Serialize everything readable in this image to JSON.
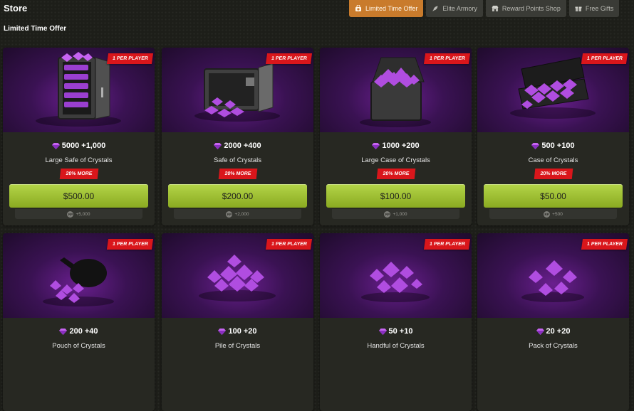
{
  "header": {
    "title": "Store",
    "section_title": "Limited Time Offer",
    "tabs": [
      {
        "label": "Limited Time Offer",
        "icon": "clock-bag-icon",
        "active": true
      },
      {
        "label": "Elite Armory",
        "icon": "rocket-icon",
        "active": false
      },
      {
        "label": "Reward Points Shop",
        "icon": "shop-icon",
        "active": false
      },
      {
        "label": "Free Gifts",
        "icon": "gift-icon",
        "active": false
      }
    ]
  },
  "colors": {
    "accent_tab": "#c97b2c",
    "buy_button": "#a4c637",
    "badge_red": "#d9161b",
    "crystal_purple": "#b04de0"
  },
  "cards": [
    {
      "badge": "1 PER PLAYER",
      "amount": "5000",
      "bonus": "+1,000",
      "name": "Large Safe of Crystals",
      "more": "20% MORE",
      "price": "$500.00",
      "rp_icon": "RP",
      "rp": "+5,000",
      "image": "large-safe-icon"
    },
    {
      "badge": "1 PER PLAYER",
      "amount": "2000",
      "bonus": "+400",
      "name": "Safe of Crystals",
      "more": "20% MORE",
      "price": "$200.00",
      "rp_icon": "RP",
      "rp": "+2,000",
      "image": "safe-icon"
    },
    {
      "badge": "1 PER PLAYER",
      "amount": "1000",
      "bonus": "+200",
      "name": "Large Case of Crystals",
      "more": "20% MORE",
      "price": "$100.00",
      "rp_icon": "RP",
      "rp": "+1,000",
      "image": "large-case-icon"
    },
    {
      "badge": "1 PER PLAYER",
      "amount": "500",
      "bonus": "+100",
      "name": "Case of Crystals",
      "more": "20% MORE",
      "price": "$50.00",
      "rp_icon": "RP",
      "rp": "+500",
      "image": "briefcase-icon"
    },
    {
      "badge": "1 PER PLAYER",
      "amount": "200",
      "bonus": "+40",
      "name": "Pouch of Crystals",
      "image": "pouch-icon"
    },
    {
      "badge": "1 PER PLAYER",
      "amount": "100",
      "bonus": "+20",
      "name": "Pile of Crystals",
      "image": "crystal-pile-icon"
    },
    {
      "badge": "1 PER PLAYER",
      "amount": "50",
      "bonus": "+10",
      "name": "Handful of Crystals",
      "image": "crystal-handful-icon"
    },
    {
      "badge": "1 PER PLAYER",
      "amount": "20",
      "bonus": "+20",
      "name": "Pack of Crystals",
      "image": "crystal-pack-icon"
    }
  ]
}
